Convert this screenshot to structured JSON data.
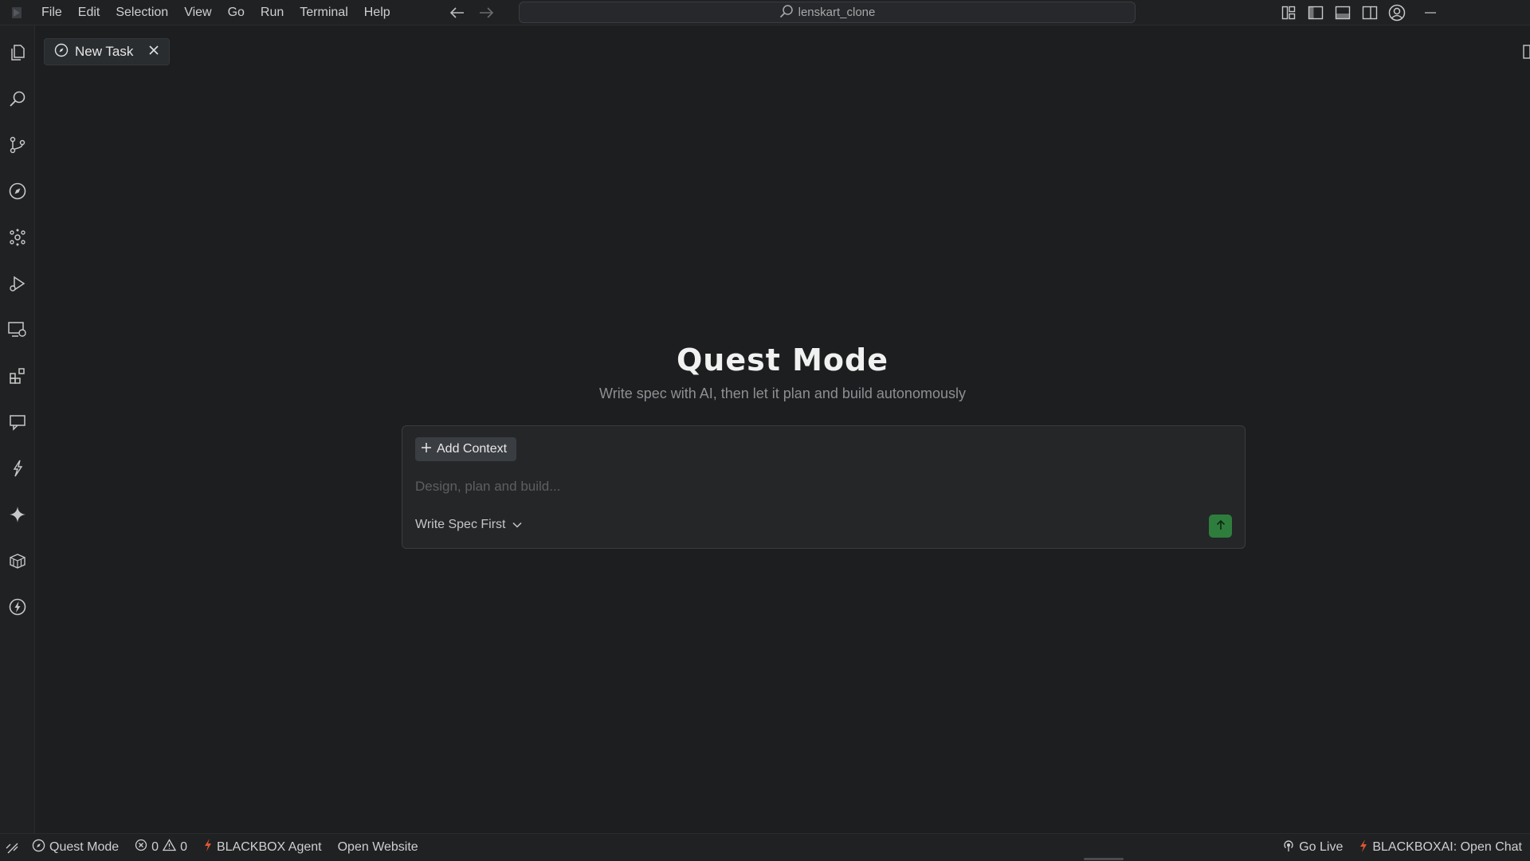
{
  "menu": {
    "items": [
      "File",
      "Edit",
      "Selection",
      "View",
      "Go",
      "Run",
      "Terminal",
      "Help"
    ]
  },
  "command_center": {
    "text": "lenskart_clone",
    "icon": "search-icon"
  },
  "titlebar_icons": [
    "customize-layout-icon",
    "toggle-primary-sidebar-icon",
    "toggle-panel-icon",
    "toggle-secondary-sidebar-icon",
    "accounts-icon",
    "minimize-icon"
  ],
  "activity_icons": [
    "explorer-icon",
    "search-icon",
    "source-control-icon",
    "compass-icon",
    "extensions-cluster-icon",
    "run-debug-icon",
    "remote-explorer-icon",
    "extensions-icon",
    "chat-icon",
    "bolt-icon",
    "sparkle-icon",
    "package-icon",
    "lightning-circle-icon"
  ],
  "tab": {
    "label": "New Task",
    "icon": "compass-icon"
  },
  "quest": {
    "title": "Quest Mode",
    "subtitle": "Write spec with AI, then let it plan and build autonomously",
    "add_context_label": "Add Context",
    "input_placeholder": "Design, plan and build...",
    "input_value": "",
    "mode_label": "Write Spec First"
  },
  "statusbar": {
    "quest_mode": "Quest Mode",
    "errors": "0",
    "warnings": "0",
    "agent": "BLACKBOX Agent",
    "open_website": "Open Website",
    "go_live": "Go Live",
    "open_chat": "BLACKBOXAI: Open Chat"
  },
  "colors": {
    "background": "#1c1e20",
    "send_button": "#2e7d3c",
    "bolt_accent": "#e0562e"
  }
}
